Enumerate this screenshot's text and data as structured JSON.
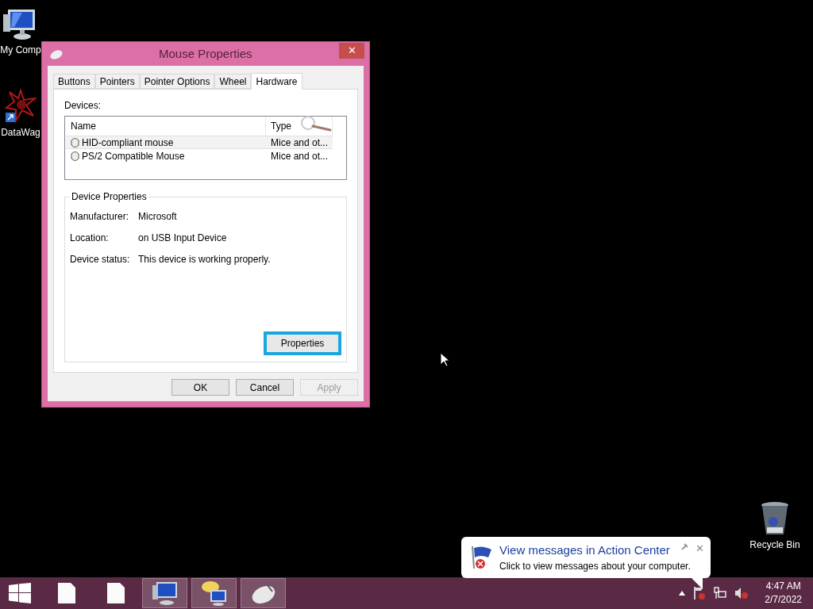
{
  "close_glyph": "✕",
  "desktop_icons": [
    {
      "label": "My Comp",
      "kind": "computer"
    },
    {
      "label": "DataWag",
      "kind": "app"
    },
    {
      "label": "Recycle Bin",
      "kind": "recycle"
    }
  ],
  "dialog": {
    "title": "Mouse Properties",
    "tabs": [
      {
        "label": "Buttons",
        "selected": false
      },
      {
        "label": "Pointers",
        "selected": false
      },
      {
        "label": "Pointer Options",
        "selected": false
      },
      {
        "label": "Wheel",
        "selected": false
      },
      {
        "label": "Hardware",
        "selected": true
      }
    ],
    "devices_label": "Devices:",
    "columns": [
      "Name",
      "Type"
    ],
    "rows": [
      {
        "name": "HID-compliant mouse",
        "type": "Mice and ot...",
        "selected": true
      },
      {
        "name": "PS/2 Compatible Mouse",
        "type": "Mice and ot...",
        "selected": false
      }
    ],
    "group_title": "Device Properties",
    "properties": [
      {
        "label": "Manufacturer:",
        "value": "Microsoft"
      },
      {
        "label": "Location:",
        "value": "on USB Input Device"
      },
      {
        "label": "Device status:",
        "value": "This device is working properly."
      }
    ],
    "properties_button": {
      "label": "Properties",
      "focused": true
    },
    "buttons": [
      {
        "label": "OK",
        "disabled": false
      },
      {
        "label": "Cancel",
        "disabled": false
      },
      {
        "label": "Apply",
        "disabled": true
      }
    ]
  },
  "notification": {
    "title": "View messages in Action Center",
    "text": "Click to view messages about your computer."
  },
  "taskbar": {
    "items": [
      {
        "kind": "start",
        "running": false
      },
      {
        "kind": "file",
        "running": false
      },
      {
        "kind": "file",
        "running": false
      },
      {
        "kind": "computer",
        "running": true
      },
      {
        "kind": "chat",
        "running": true
      },
      {
        "kind": "mouse",
        "running": true
      }
    ],
    "time": "4:47 AM",
    "date": "2/7/2022"
  }
}
